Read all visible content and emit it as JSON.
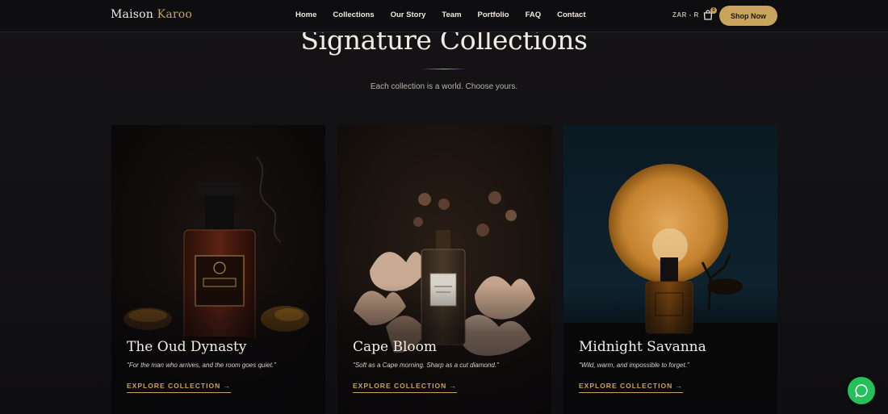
{
  "nav": {
    "brand_main": "Maison",
    "brand_accent": "Karoo",
    "items": [
      {
        "label": "Home"
      },
      {
        "label": "Collections"
      },
      {
        "label": "Our Story"
      },
      {
        "label": "Team"
      },
      {
        "label": "Portfolio"
      },
      {
        "label": "FAQ"
      },
      {
        "label": "Contact"
      }
    ],
    "currency": "ZAR - R",
    "cart_count": "0",
    "cta": "Shop Now"
  },
  "section": {
    "title": "Signature Collections",
    "subtitle": "Each collection is a world. Choose yours."
  },
  "cards": [
    {
      "title": "The Oud Dynasty",
      "quote": "\"For the man who arrives, and the room goes quiet.\"",
      "link": "EXPLORE COLLECTION →"
    },
    {
      "title": "Cape Bloom",
      "quote": "\"Soft as a Cape morning. Sharp as a cut diamond.\"",
      "link": "EXPLORE COLLECTION →"
    },
    {
      "title": "Midnight Savanna",
      "quote": "\"Wild, warm, and impossible to forget.\"",
      "link": "EXPLORE COLLECTION →"
    }
  ],
  "colors": {
    "accent": "#c9a45c",
    "background": "#121113",
    "chat": "#25c05a"
  },
  "icons": {
    "cart": "shopping-bag-icon",
    "chat": "chat-bubble-icon"
  }
}
